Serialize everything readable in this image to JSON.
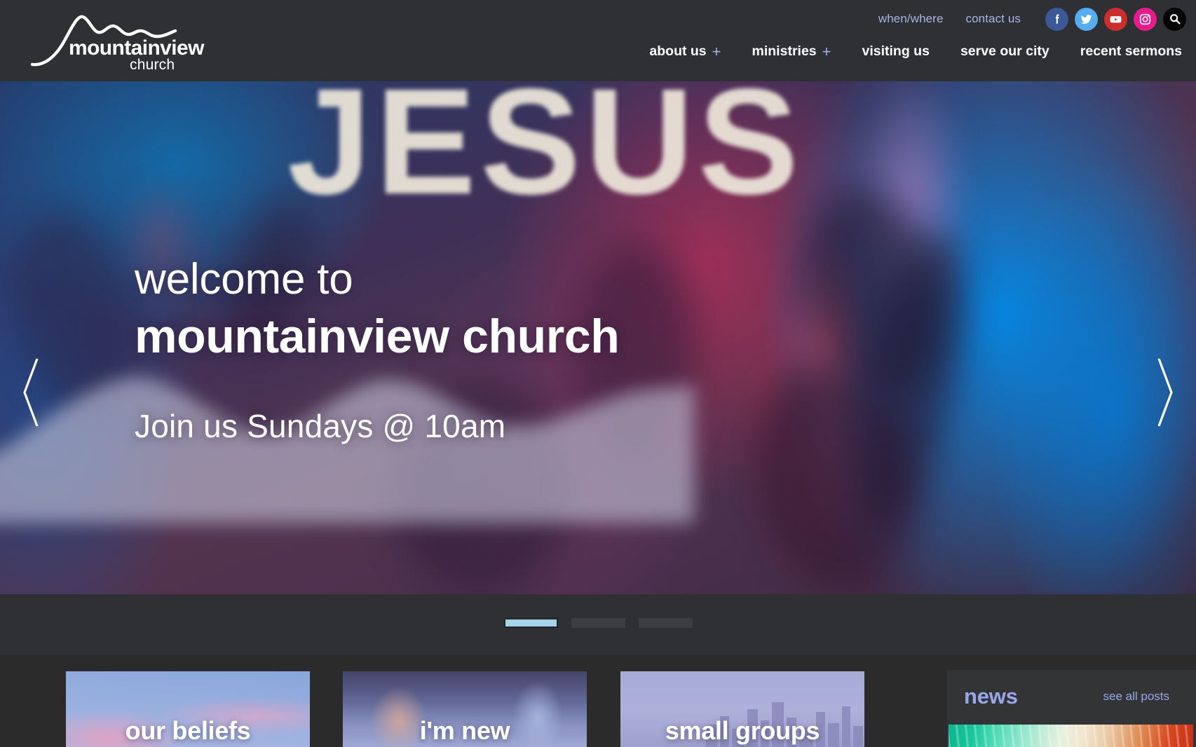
{
  "site": {
    "logo_primary": "mountainview",
    "logo_secondary": "church"
  },
  "header": {
    "top_links": [
      {
        "label": "when/where"
      },
      {
        "label": "contact us"
      }
    ],
    "social": [
      {
        "name": "facebook-icon",
        "color": "#3b5998"
      },
      {
        "name": "twitter-icon",
        "color": "#55acee"
      },
      {
        "name": "youtube-icon",
        "color": "#cc2e2e"
      },
      {
        "name": "instagram-icon",
        "color": "#e61c8c"
      },
      {
        "name": "search-icon",
        "color": "#060606"
      }
    ],
    "nav": [
      {
        "label": "about us",
        "expand": "+"
      },
      {
        "label": "ministries",
        "expand": "+"
      },
      {
        "label": "visiting us",
        "expand": ""
      },
      {
        "label": "serve our city",
        "expand": ""
      },
      {
        "label": "recent sermons",
        "expand": ""
      }
    ]
  },
  "hero": {
    "background_text": "JESUS",
    "welcome_line": "welcome to",
    "headline": "mountainview church",
    "subline": "Join us Sundays @ 10am",
    "prev_label": "‹",
    "next_label": "›",
    "slides": [
      {
        "active": true
      },
      {
        "active": false
      },
      {
        "active": false
      }
    ],
    "active_slide_color": "#a6d4ea"
  },
  "cards": [
    {
      "label": "our beliefs"
    },
    {
      "label": "i'm new"
    },
    {
      "label": "small groups"
    }
  ],
  "news": {
    "title": "news",
    "see_all_label": "see all posts",
    "accent_color": "#9aa8ea"
  }
}
